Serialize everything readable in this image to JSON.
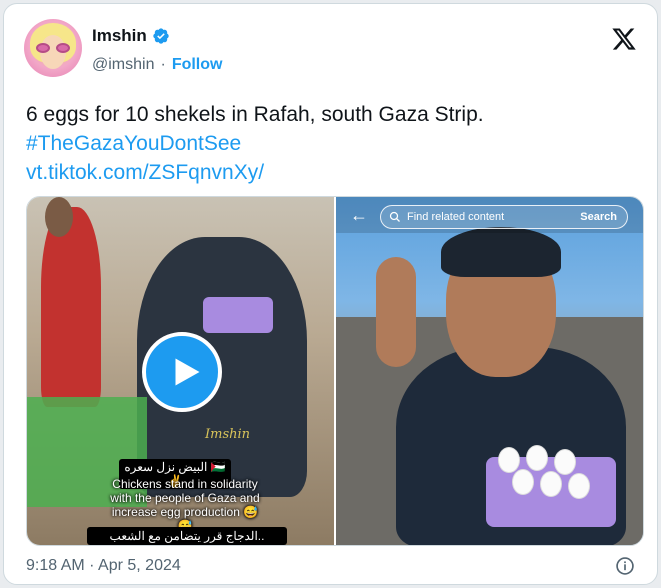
{
  "author": {
    "name": "Imshin",
    "handle": "@imshin",
    "separator": "·",
    "follow_label": "Follow"
  },
  "tweet": {
    "text": "6 eggs for 10 shekels in Rafah, south Gaza Strip.",
    "hashtag": "#TheGazaYouDontSee",
    "link": "vt.tiktok.com/ZSFqnvnXy/"
  },
  "media_left": {
    "watermark": "Imshin",
    "arabic_top": "البيض نزل سعره 🇵🇸✌️",
    "caption": "Chickens stand in solidarity with the people of Gaza and increase egg production 😅😅",
    "arabic_bottom": "الدجاج قرر يتضامن مع الشعب.."
  },
  "media_right": {
    "search_placeholder": "Find related content",
    "search_button": "Search"
  },
  "footer": {
    "timestamp": "9:18 AM · Apr 5, 2024"
  },
  "colors": {
    "accent": "#1d9bf0",
    "secondary_text": "#536471",
    "border": "#cfd9de"
  },
  "icons": [
    "verified-badge-icon",
    "x-logo-icon",
    "play-icon",
    "back-arrow-icon",
    "search-icon",
    "info-icon"
  ]
}
